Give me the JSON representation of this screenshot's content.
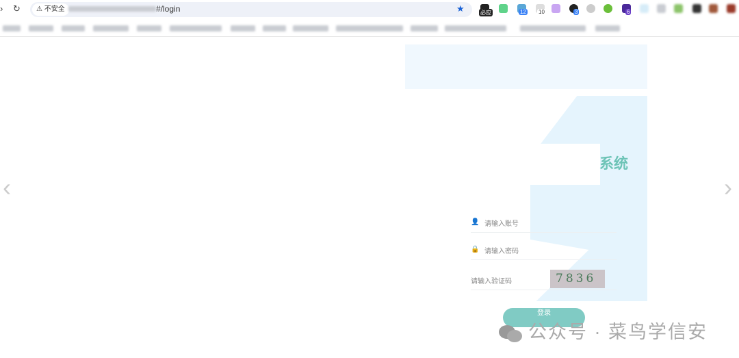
{
  "browser": {
    "security_label": "不安全",
    "url_suffix": "#/login",
    "badges": [
      "必应",
      "12",
      "10",
      "3",
      "6"
    ]
  },
  "page": {
    "title_partial": "系统",
    "account_placeholder": "请输入账号",
    "password_placeholder": "请输入密码",
    "captcha_placeholder": "请输入验证码",
    "captcha_text": "7836",
    "login_label": "登录"
  },
  "watermark": "公众号 · 菜鸟学信安",
  "colors": {
    "accent": "#80cbc4",
    "title": "#6cc3b6"
  }
}
